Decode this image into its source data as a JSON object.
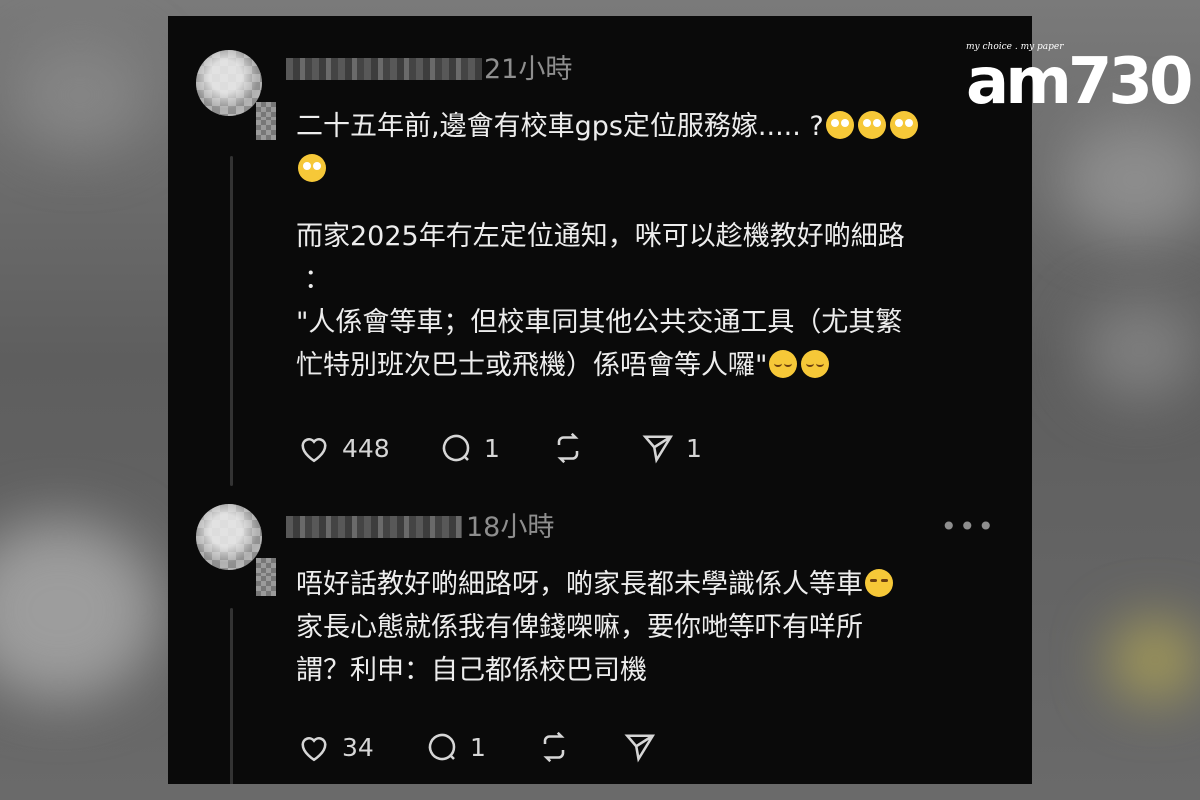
{
  "logo": {
    "tagline": "my choice . my paper",
    "mark": "am730"
  },
  "comments": [
    {
      "time": "21小時",
      "lines": [
        "二十五年前,邊會有校車gps定位服務嫁..... ?",
        "",
        "而家2025年冇左定位通知，咪可以趁機教好啲細路",
        "：",
        "\"人係會等車；但校車同其他公共交通工具（尤其繁",
        "忙特別班次巴士或飛機）係唔會等人囉\""
      ],
      "likes": "448",
      "replies": "1",
      "shares": "1"
    },
    {
      "time": "18小時",
      "more": "•••",
      "lines": [
        "唔好話教好啲細路呀，啲家長都未學識係人等車",
        "家長心態就係我有俾錢㗎嘛，要你哋等吓有咩所",
        "謂？利申：自己都係校巴司機"
      ],
      "likes": "34",
      "replies": "1"
    }
  ],
  "icons": {
    "like": "heart-icon",
    "reply": "comment-bubble-icon",
    "repost": "repost-icon",
    "share": "send-icon",
    "emoji_1": "face-with-rolling-eyes",
    "emoji_2": "relieved-face",
    "emoji_3": "expressionless-face"
  }
}
